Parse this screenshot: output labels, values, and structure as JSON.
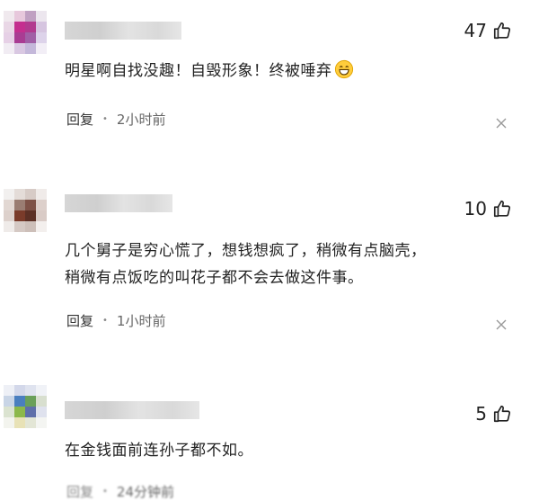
{
  "comments": [
    {
      "likes": "47",
      "text_lines": [
        "明星啊自找没趣！自毁形象！终被唾弃"
      ],
      "emoji": "grinning-face-emoji",
      "reply_label": "回复",
      "time": "2小时前"
    },
    {
      "likes": "10",
      "text_lines": [
        "几个舅子是穷心慌了，想钱想疯了，稍微有点脑壳，",
        "稍微有点饭吃的叫花子都不会去做这件事。"
      ],
      "reply_label": "回复",
      "time": "1小时前"
    },
    {
      "likes": "5",
      "text_lines": [
        "在金钱面前连孙子都不如。"
      ],
      "reply_label": "回复",
      "time": "24分钟前"
    }
  ]
}
